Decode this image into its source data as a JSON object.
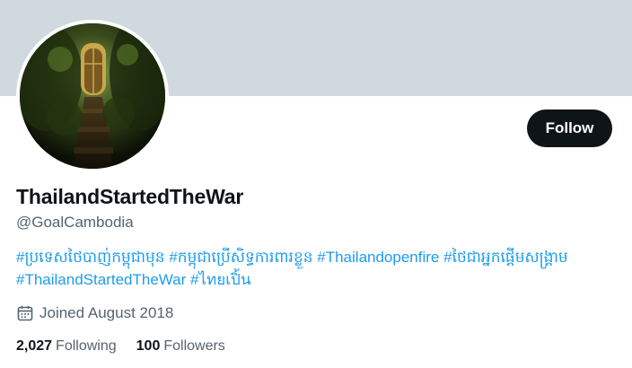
{
  "profile": {
    "display_name": "ThailandStartedTheWar",
    "handle": "@GoalCambodia",
    "follow_label": "Follow",
    "bio_hashtags": [
      "#ប្រទេសថៃបាញ់កម្ពុជាមុន",
      "#កម្ពុជាប្រើសិទ្ធការពារខ្លួន",
      "#Thailandopenfire",
      "#ថៃជាអ្នកផ្តើមសង្គ្រាម",
      "#ThailandStartedTheWar",
      "#ไทยเปิ้น"
    ],
    "joined": "Joined August 2018",
    "following_count": "2,027",
    "following_label": "Following",
    "followers_count": "100",
    "followers_label": "Followers"
  },
  "colors": {
    "banner": "#cfd9de",
    "link": "#1d9bf0",
    "button_bg": "#0f1419",
    "muted_text": "#536471"
  },
  "icons": {
    "joined": "calendar-icon"
  }
}
